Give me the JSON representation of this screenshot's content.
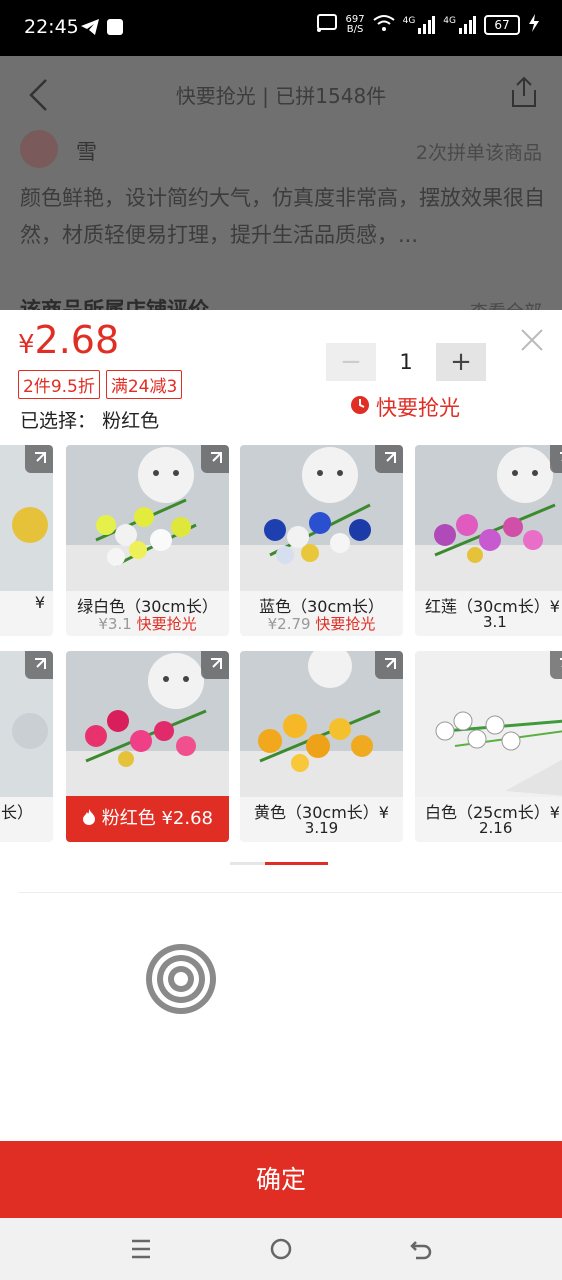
{
  "status_bar": {
    "time": "22:45",
    "net_speed": "697",
    "net_unit": "B/S",
    "net1": "4G",
    "net2": "4G",
    "battery": "67"
  },
  "background": {
    "title": "快要抢光 | 已拼1548件",
    "reviewer_name": "雪",
    "reviewer_count": "2次拼单该商品",
    "review_text": "颜色鲜艳，设计简约大气，仿真度非常高，摆放效果很自然，材质轻便易打理，提升生活品质感，...",
    "section_title": "该商品所属店铺评价",
    "see_all": "查看全部"
  },
  "sheet": {
    "price_symbol": "¥",
    "price_value": "2.68",
    "tags": [
      "2件9.5折",
      "满24减3"
    ],
    "selected_label": "已选择：",
    "selected_value": "粉红色",
    "quantity": "1",
    "flash_label": "快要抢光",
    "confirm_label": "确定"
  },
  "variants": [
    {
      "name": "¥",
      "old_price": "",
      "status": ""
    },
    {
      "name": "绿白色（30cm长）",
      "old_price": "¥3.1",
      "status": "快要抢光"
    },
    {
      "name": "蓝色（30cm长）",
      "old_price": "¥2.79",
      "status": "快要抢光"
    },
    {
      "name": "红莲（30cm长）¥",
      "old_price": "3.1",
      "status": ""
    },
    {
      "name": "长）",
      "old_price": "",
      "status": ""
    },
    {
      "name": "粉红色 ¥2.68",
      "old_price": "",
      "status": ""
    },
    {
      "name": "黄色（30cm长）¥",
      "old_price": "3.19",
      "status": ""
    },
    {
      "name": "白色（25cm长）¥",
      "old_price": "2.16",
      "status": ""
    }
  ],
  "colors": {
    "accent": "#e02e24"
  }
}
